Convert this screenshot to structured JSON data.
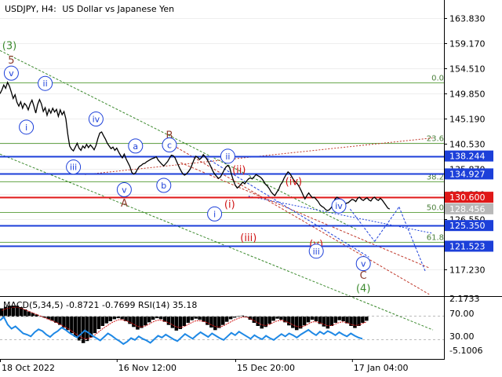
{
  "header": {
    "symbol_tf": "USDJPY, H4:",
    "description": "US Dollar vs Japanese Yen"
  },
  "colors": {
    "price_line": "#000000",
    "fib_line": "#6aa84f",
    "fib_label": "#4a7f3a",
    "support_line": "#1c3fd9",
    "resistance_line": "#e01818",
    "current_badge": "#b8b8b8",
    "wave_blue": "#1c3fd9",
    "wave_red": "#d01414",
    "wave_brown": "#8b3a2a",
    "wave_green": "#3c8a2e",
    "macd_hist": "#000000",
    "macd_signal": "#d01414",
    "rsi": "#1e88e5",
    "channel_green": "#3c8a2e",
    "channel_red": "#c0392b",
    "channel_blue": "#1c3fd9"
  },
  "chart_data": [
    {
      "type": "line",
      "title": "USDJPY, H4: US Dollar vs Japanese Yen",
      "ylim": [
        113.0,
        166.0
      ],
      "y_ticks": [
        "163.830",
        "159.170",
        "154.510",
        "149.850",
        "145.190",
        "140.530",
        "135.870",
        "131.210",
        "126.550",
        "117.230"
      ],
      "y_tick_values": [
        163.83,
        159.17,
        154.51,
        149.85,
        145.19,
        140.53,
        135.87,
        131.21,
        126.55,
        117.23
      ],
      "x_labels": [
        "18 Oct 2022",
        "16 Nov 12:00",
        "15 Dec 20:00",
        "17 Jan 04:00"
      ],
      "x_label_bars": [
        0,
        62,
        125,
        187
      ],
      "series": [
        {
          "values": [
            149.8,
            150.5,
            151.4,
            150.8,
            151.9,
            151.2,
            150.1,
            148.9,
            149.6,
            148.2,
            147.5,
            148.3,
            147.1,
            148.0,
            147.6,
            146.8,
            147.9,
            148.6,
            147.5,
            146.2,
            147.8,
            148.7,
            147.9,
            146.5,
            147.2,
            145.8,
            146.9,
            146.2,
            147.1,
            146.4,
            146.9,
            145.6,
            146.8,
            145.9,
            146.5,
            145.1,
            142.3,
            140.1,
            139.5,
            139.2,
            139.9,
            140.6,
            139.7,
            139.3,
            140.1,
            139.7,
            140.4,
            139.8,
            140.3,
            139.9,
            139.4,
            140.2,
            141.5,
            142.5,
            142.7,
            142.0,
            141.4,
            140.6,
            140.1,
            139.6,
            139.9,
            139.3,
            139.7,
            139.0,
            138.4,
            137.9,
            138.6,
            137.7,
            137.0,
            136.3,
            135.2,
            134.9,
            135.1,
            135.8,
            136.3,
            136.5,
            136.8,
            136.9,
            137.2,
            137.4,
            137.6,
            137.8,
            137.9,
            138.1,
            137.5,
            137.1,
            136.7,
            136.4,
            136.8,
            137.2,
            137.8,
            138.4,
            138.3,
            137.9,
            137.1,
            136.3,
            135.6,
            135.0,
            134.7,
            134.9,
            135.3,
            135.8,
            136.6,
            137.5,
            138.2,
            138.0,
            137.6,
            137.9,
            138.5,
            138.1,
            137.6,
            137.0,
            136.3,
            135.5,
            134.9,
            134.5,
            134.1,
            134.3,
            134.9,
            135.6,
            136.2,
            136.5,
            136.1,
            134.8,
            133.7,
            132.8,
            132.3,
            132.6,
            133.0,
            133.4,
            133.1,
            133.6,
            134.0,
            134.2,
            134.0,
            134.4,
            134.8,
            134.6,
            134.4,
            134.1,
            133.6,
            133.0,
            132.7,
            132.2,
            131.6,
            131.2,
            130.9,
            131.5,
            132.0,
            132.9,
            133.4,
            134.2,
            134.8,
            135.3,
            135.0,
            134.4,
            133.8,
            133.4,
            133.1,
            132.5,
            131.8,
            131.0,
            130.3,
            130.9,
            131.4,
            130.9,
            130.5,
            130.6,
            130.2,
            129.8,
            129.2,
            128.9,
            128.7,
            128.3,
            128.1,
            128.3,
            128.7,
            129.4,
            130.3,
            130.6,
            130.4,
            129.9,
            129.4,
            129.2,
            129.5,
            129.6,
            129.9,
            130.2,
            130.1,
            129.8,
            130.4,
            130.6,
            130.2,
            130.0,
            130.3,
            130.5,
            130.1,
            129.9,
            130.4,
            130.6,
            130.2,
            130.0,
            130.4,
            130.1,
            129.6,
            129.1,
            128.6,
            128.4
          ]
        }
      ],
      "levels": [
        {
          "label": "138.244",
          "value": 138.244,
          "role": "support-blue",
          "badge": "138.244"
        },
        {
          "label": "134.927",
          "value": 134.927,
          "role": "support-blue",
          "badge": "134.927"
        },
        {
          "label": "130.600",
          "value": 130.6,
          "role": "resistance-red",
          "badge": "130.600"
        },
        {
          "label": "128.456",
          "value": 128.456,
          "role": "current",
          "badge": "128.456"
        },
        {
          "label": "125.350",
          "value": 125.35,
          "role": "support-blue",
          "badge": "125.350"
        },
        {
          "label": "121.523",
          "value": 121.523,
          "role": "support-blue",
          "badge": "121.523"
        }
      ],
      "fibonacci": [
        {
          "label": "0.0",
          "value": 151.9
        },
        {
          "label": "23.6",
          "value": 140.6
        },
        {
          "label": "38.2",
          "value": 133.6
        },
        {
          "label": "50.0",
          "value": 127.9
        },
        {
          "label": "61.8",
          "value": 122.3
        }
      ],
      "wave_labels": [
        {
          "text": "(3)",
          "bar": 5,
          "price": 158.8,
          "color": "green"
        },
        {
          "text": "5",
          "bar": 6,
          "price": 156.1,
          "color": "brown"
        },
        {
          "text": "v",
          "bar": 6,
          "price": 153.6,
          "color": "blue",
          "circled": true
        },
        {
          "text": "ii",
          "bar": 24,
          "price": 151.7,
          "color": "blue",
          "circled": true
        },
        {
          "text": "i",
          "bar": 14,
          "price": 143.6,
          "color": "blue",
          "circled": true
        },
        {
          "text": "iv",
          "bar": 51,
          "price": 145.1,
          "color": "blue",
          "circled": true
        },
        {
          "text": "iii",
          "bar": 39,
          "price": 136.2,
          "color": "blue",
          "circled": true
        },
        {
          "text": "a",
          "bar": 72,
          "price": 140.1,
          "color": "blue",
          "circled": true
        },
        {
          "text": "B",
          "bar": 90,
          "price": 142.2,
          "color": "brown"
        },
        {
          "text": "c",
          "bar": 90,
          "price": 140.3,
          "color": "blue",
          "circled": true
        },
        {
          "text": "v",
          "bar": 66,
          "price": 132.0,
          "color": "blue",
          "circled": true
        },
        {
          "text": "A",
          "bar": 66,
          "price": 129.6,
          "color": "brown"
        },
        {
          "text": "b",
          "bar": 87,
          "price": 132.8,
          "color": "blue",
          "circled": true
        },
        {
          "text": "ii",
          "bar": 121,
          "price": 138.2,
          "color": "blue",
          "circled": true
        },
        {
          "text": "(ii)",
          "bar": 127,
          "price": 135.8,
          "color": "red"
        },
        {
          "text": "(i)",
          "bar": 122,
          "price": 129.4,
          "color": "red"
        },
        {
          "text": "i",
          "bar": 114,
          "price": 127.5,
          "color": "blue",
          "circled": true
        },
        {
          "text": "(iii)",
          "bar": 132,
          "price": 123.2,
          "color": "red"
        },
        {
          "text": "(iv)",
          "bar": 156,
          "price": 133.6,
          "color": "red"
        },
        {
          "text": "iv",
          "bar": 180,
          "price": 129.0,
          "color": "blue",
          "circled": true
        },
        {
          "text": "(v)",
          "bar": 168,
          "price": 122.0,
          "color": "red"
        },
        {
          "text": "iii",
          "bar": 168,
          "price": 120.6,
          "color": "blue",
          "circled": true
        },
        {
          "text": "v",
          "bar": 193,
          "price": 118.3,
          "color": "blue",
          "circled": true
        },
        {
          "text": "C",
          "bar": 193,
          "price": 116.2,
          "color": "brown"
        },
        {
          "text": "(4)",
          "bar": 193,
          "price": 113.8,
          "color": "green"
        }
      ]
    },
    {
      "type": "bar",
      "title": "MACD(5,34,5) -0.8721 -0.7699 RSI(14) 35.18",
      "ylim": [
        -8.0,
        3.5
      ],
      "y_ticks": [
        "2.1733",
        "70.00",
        "30.00",
        "-5.1006"
      ],
      "macd_hist": [
        1.6,
        1.9,
        2.1,
        2.0,
        2.1,
        1.8,
        1.4,
        1.0,
        0.7,
        0.4,
        0.1,
        -0.2,
        -0.5,
        -0.8,
        -1.2,
        -1.6,
        -2.1,
        -2.6,
        -3.2,
        -3.9,
        -4.6,
        -5.1,
        -4.7,
        -4.0,
        -3.2,
        -2.4,
        -1.8,
        -1.3,
        -0.9,
        -0.5,
        -0.3,
        -0.5,
        -0.9,
        -1.4,
        -2.0,
        -2.5,
        -2.2,
        -1.7,
        -1.1,
        -0.6,
        -0.3,
        -0.5,
        -1.0,
        -1.6,
        -2.2,
        -2.7,
        -2.4,
        -1.8,
        -1.2,
        -0.7,
        -0.4,
        -0.6,
        -1.0,
        -1.6,
        -2.1,
        -2.6,
        -2.2,
        -1.6,
        -1.0,
        -0.5,
        -0.2,
        0.1,
        0.2,
        -0.1,
        -0.6,
        -1.2,
        -1.8,
        -2.3,
        -2.0,
        -1.4,
        -0.8,
        -0.4,
        -0.6,
        -1.1,
        -1.7,
        -2.2,
        -2.6,
        -2.3,
        -1.7,
        -1.1,
        -0.6,
        -0.9,
        -1.4,
        -1.9,
        -2.3,
        -1.8,
        -1.2,
        -0.7,
        -0.9,
        -1.3,
        -1.8,
        -2.2,
        -1.8,
        -1.2,
        -0.8
      ],
      "macd_signal": [
        1.2,
        1.5,
        1.7,
        1.8,
        1.8,
        1.6,
        1.3,
        1.0,
        0.7,
        0.4,
        0.1,
        -0.2,
        -0.5,
        -0.8,
        -1.1,
        -1.5,
        -1.9,
        -2.3,
        -2.8,
        -3.3,
        -3.8,
        -4.2,
        -4.3,
        -4.0,
        -3.5,
        -2.9,
        -2.3,
        -1.8,
        -1.3,
        -0.9,
        -0.6,
        -0.6,
        -0.8,
        -1.1,
        -1.5,
        -1.9,
        -2.0,
        -1.8,
        -1.4,
        -1.0,
        -0.7,
        -0.7,
        -0.9,
        -1.2,
        -1.6,
        -2.0,
        -2.1,
        -1.9,
        -1.5,
        -1.1,
        -0.8,
        -0.8,
        -0.9,
        -1.2,
        -1.6,
        -1.9,
        -2.0,
        -1.8,
        -1.4,
        -1.0,
        -0.6,
        -0.3,
        -0.1,
        -0.1,
        -0.4,
        -0.8,
        -1.2,
        -1.6,
        -1.7,
        -1.5,
        -1.1,
        -0.8,
        -0.7,
        -0.9,
        -1.2,
        -1.6,
        -1.9,
        -2.0,
        -1.8,
        -1.4,
        -1.0,
        -1.0,
        -1.2,
        -1.5,
        -1.8,
        -1.7,
        -1.4,
        -1.1,
        -1.0,
        -1.2,
        -1.5,
        -1.7,
        -1.6,
        -1.3,
        -1.0
      ],
      "rsi": [
        62,
        68,
        55,
        48,
        52,
        46,
        40,
        38,
        35,
        42,
        47,
        44,
        38,
        34,
        40,
        44,
        50,
        46,
        41,
        37,
        33,
        39,
        45,
        41,
        36,
        32,
        28,
        34,
        40,
        36,
        31,
        27,
        22,
        26,
        32,
        29,
        35,
        31,
        28,
        24,
        30,
        36,
        33,
        38,
        34,
        30,
        27,
        33,
        39,
        35,
        31,
        37,
        42,
        38,
        34,
        40,
        36,
        32,
        29,
        35,
        41,
        37,
        43,
        39,
        35,
        31,
        37,
        33,
        30,
        36,
        32,
        29,
        34,
        39,
        35,
        40,
        37,
        33,
        38,
        42,
        46,
        41,
        37,
        43,
        39,
        44,
        41,
        37,
        42,
        38,
        35,
        40,
        36,
        33,
        31
      ]
    }
  ]
}
